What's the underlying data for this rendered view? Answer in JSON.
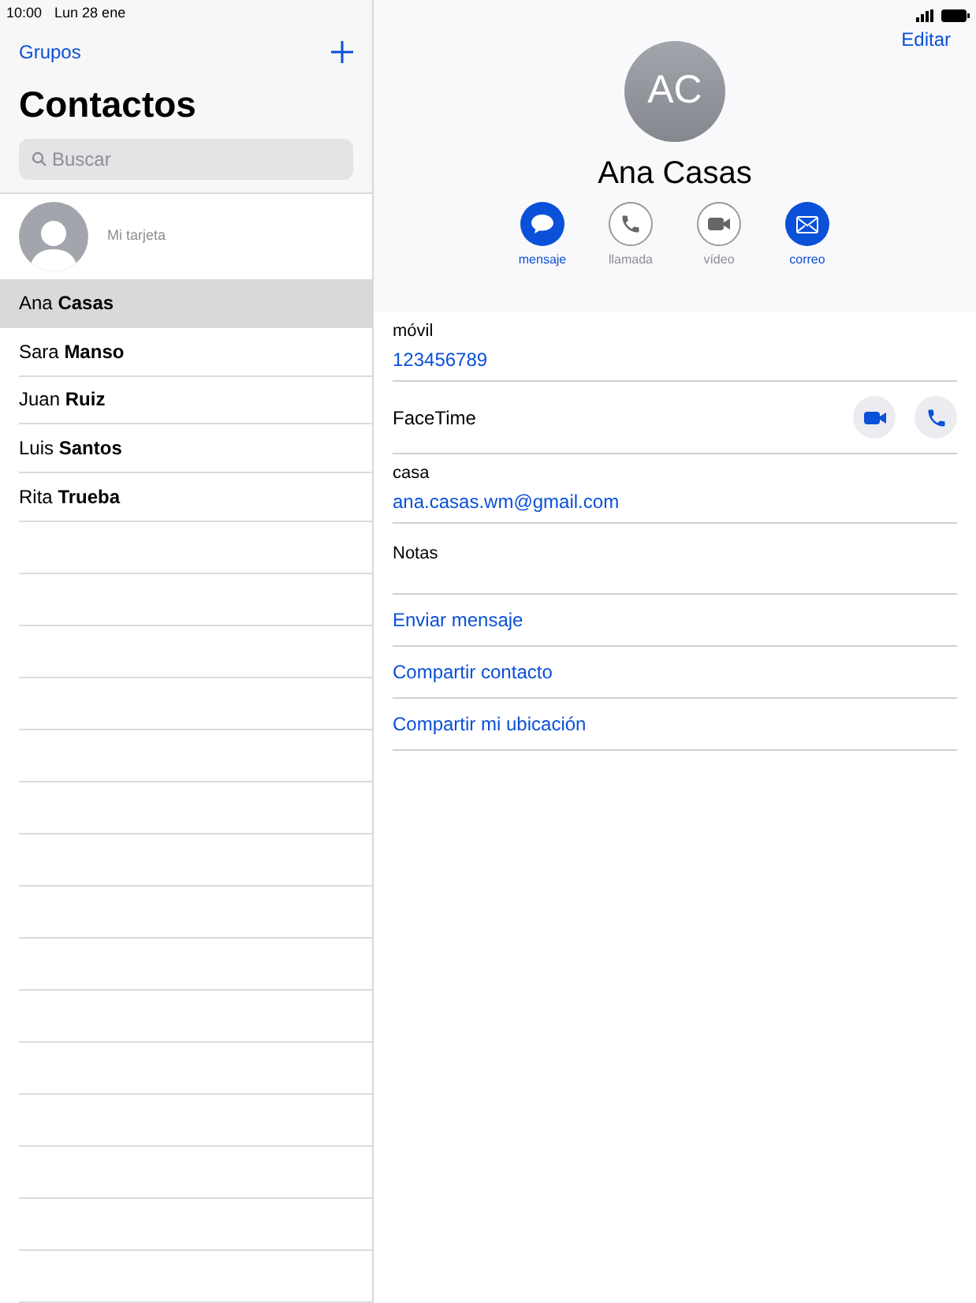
{
  "status_bar": {
    "time": "10:00",
    "date": "Lun 28 ene"
  },
  "sidebar": {
    "groups_link": "Grupos",
    "title": "Contactos",
    "search": {
      "placeholder": "Buscar"
    },
    "my_card": "Mi tarjeta",
    "contacts": [
      {
        "first": "Ana",
        "last": "Casas",
        "selected": true
      },
      {
        "first": "Sara",
        "last": "Manso",
        "selected": false
      },
      {
        "first": "Juan",
        "last": "Ruiz",
        "selected": false
      },
      {
        "first": "Luis",
        "last": "Santos",
        "selected": false
      },
      {
        "first": "Rita",
        "last": "Trueba",
        "selected": false
      }
    ]
  },
  "detail": {
    "edit_link": "Editar",
    "initials": "AC",
    "name": "Ana Casas",
    "actions": [
      {
        "kind": "message",
        "label": "mensaje",
        "enabled": true
      },
      {
        "kind": "call",
        "label": "llamada",
        "enabled": false
      },
      {
        "kind": "video",
        "label": "vídeo",
        "enabled": false
      },
      {
        "kind": "mail",
        "label": "correo",
        "enabled": true
      }
    ],
    "fields": [
      {
        "kind": "value",
        "label": "móvil",
        "value": "123456789"
      },
      {
        "kind": "facetime",
        "label": "FaceTime"
      },
      {
        "kind": "value",
        "label": "casa",
        "value": "ana.casas.wm@gmail.com"
      },
      {
        "kind": "notes",
        "label": "Notas"
      }
    ],
    "links": [
      "Enviar mensaje",
      "Compartir contacto",
      "Compartir mi ubicación"
    ]
  }
}
